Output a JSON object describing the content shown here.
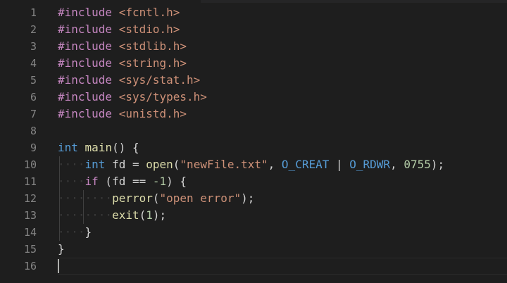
{
  "editor": {
    "line_numbers": [
      "1",
      "2",
      "3",
      "4",
      "5",
      "6",
      "7",
      "8",
      "9",
      "10",
      "11",
      "12",
      "13",
      "14",
      "15",
      "16"
    ],
    "lines": [
      [
        {
          "t": "#include ",
          "c": "kw-pre"
        },
        {
          "t": "<fcntl.h>",
          "c": "str"
        }
      ],
      [
        {
          "t": "#include ",
          "c": "kw-pre"
        },
        {
          "t": "<stdio.h>",
          "c": "str"
        }
      ],
      [
        {
          "t": "#include ",
          "c": "kw-pre"
        },
        {
          "t": "<stdlib.h>",
          "c": "str"
        }
      ],
      [
        {
          "t": "#include ",
          "c": "kw-pre"
        },
        {
          "t": "<string.h>",
          "c": "str"
        }
      ],
      [
        {
          "t": "#include ",
          "c": "kw-pre"
        },
        {
          "t": "<sys/stat.h>",
          "c": "str"
        }
      ],
      [
        {
          "t": "#include ",
          "c": "kw-pre"
        },
        {
          "t": "<sys/types.h>",
          "c": "str"
        }
      ],
      [
        {
          "t": "#include ",
          "c": "kw-pre"
        },
        {
          "t": "<unistd.h>",
          "c": "str"
        }
      ],
      [],
      [
        {
          "t": "int",
          "c": "type"
        },
        {
          "t": " ",
          "c": "plain"
        },
        {
          "t": "main",
          "c": "fn"
        },
        {
          "t": "() {",
          "c": "punc"
        }
      ],
      [
        {
          "t": "····",
          "c": "ws"
        },
        {
          "t": "int",
          "c": "type"
        },
        {
          "t": " fd ",
          "c": "plain"
        },
        {
          "t": "=",
          "c": "op"
        },
        {
          "t": " ",
          "c": "plain"
        },
        {
          "t": "open",
          "c": "fn"
        },
        {
          "t": "(",
          "c": "punc"
        },
        {
          "t": "\"newFile.txt\"",
          "c": "str"
        },
        {
          "t": ", ",
          "c": "punc"
        },
        {
          "t": "O_CREAT",
          "c": "type"
        },
        {
          "t": " | ",
          "c": "op"
        },
        {
          "t": "O_RDWR",
          "c": "type"
        },
        {
          "t": ", ",
          "c": "punc"
        },
        {
          "t": "0755",
          "c": "num"
        },
        {
          "t": ");",
          "c": "punc"
        }
      ],
      [
        {
          "t": "····",
          "c": "ws"
        },
        {
          "t": "if",
          "c": "kw-pre"
        },
        {
          "t": " (fd ",
          "c": "plain"
        },
        {
          "t": "==",
          "c": "op"
        },
        {
          "t": " ",
          "c": "plain"
        },
        {
          "t": "-1",
          "c": "num"
        },
        {
          "t": ") {",
          "c": "punc"
        }
      ],
      [
        {
          "t": "········",
          "c": "ws"
        },
        {
          "t": "perror",
          "c": "fn"
        },
        {
          "t": "(",
          "c": "punc"
        },
        {
          "t": "\"open error\"",
          "c": "str"
        },
        {
          "t": ");",
          "c": "punc"
        }
      ],
      [
        {
          "t": "········",
          "c": "ws"
        },
        {
          "t": "exit",
          "c": "fn"
        },
        {
          "t": "(",
          "c": "punc"
        },
        {
          "t": "1",
          "c": "num"
        },
        {
          "t": ");",
          "c": "punc"
        }
      ],
      [
        {
          "t": "····",
          "c": "ws"
        },
        {
          "t": "}",
          "c": "punc"
        }
      ],
      [
        {
          "t": "}",
          "c": "punc"
        }
      ],
      []
    ],
    "active_line": 16,
    "colors": {
      "background": "#1e1e1e",
      "line_number": "#858585",
      "preprocessor": "#c586c0",
      "string": "#ce9178",
      "type": "#569cd6",
      "function": "#dcdcaa",
      "number": "#b5cea8",
      "text": "#d4d4d4"
    }
  }
}
